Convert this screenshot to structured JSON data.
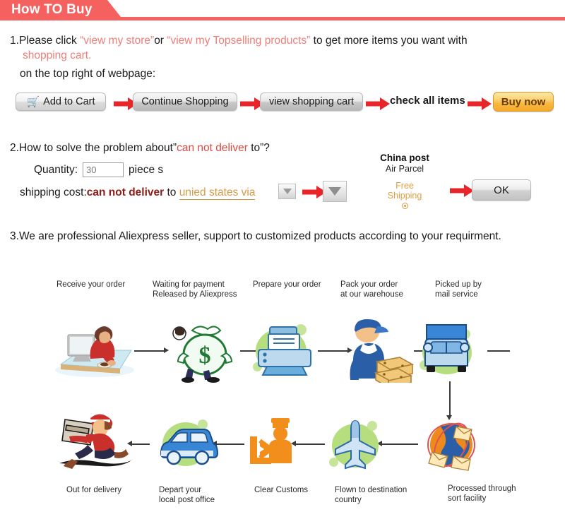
{
  "banner": {
    "title": "How TO Buy",
    "color": "#f4615e"
  },
  "step1": {
    "num": "1.",
    "lead": "Please click",
    "q_open": "“",
    "link1": "view my store",
    "q_close": "”",
    "or": "or",
    "link2": "view my Topselling products",
    "tail": "to get more items you want with",
    "line2": "shopping cart.",
    "line3": "on the top right of webpage:",
    "buttons": [
      {
        "label": "Add to Cart",
        "icon": "shopping-cart-icon",
        "style": "light"
      },
      {
        "label": "Continue Shopping",
        "style": "dark"
      },
      {
        "label": "view shopping cart",
        "style": "dark"
      },
      {
        "label": "check all items",
        "style": "plain"
      },
      {
        "label": "Buy now",
        "style": "buy"
      }
    ]
  },
  "step2": {
    "num": "2.",
    "title_a": "How to solve the problem about”",
    "title_red": "can not deliver",
    "title_b": " to”?",
    "quantity_label": "Quantity:",
    "quantity_value": "30",
    "quantity_unit": "piece s",
    "shipping_label": "shipping cost:",
    "shipping_red": "can not deliver",
    "shipping_to": "to",
    "destination": "unied states via",
    "carrier_line1": "China post",
    "carrier_line2": "Air Parcel",
    "free_line1": "Free",
    "free_line2": "Shipping",
    "ok_label": "OK"
  },
  "step3": {
    "num": "3.",
    "text": "We are professional Aliexpress seller, support to customized products according to your requirment."
  },
  "flow": {
    "top": [
      {
        "label": "Receive your order",
        "icon": "person-at-computer-icon"
      },
      {
        "label": "Waiting for payment\nReleased by Aliexpress",
        "icon": "money-bag-icon"
      },
      {
        "label": "Prepare your order",
        "icon": "printer-icon"
      },
      {
        "label": "Pack your order\nat our warehouse",
        "icon": "warehouse-worker-icon"
      },
      {
        "label": "Picked up by\nmail service",
        "icon": "delivery-truck-icon"
      }
    ],
    "bottom": [
      {
        "label": "Out for delivery",
        "icon": "running-courier-icon"
      },
      {
        "label": "Depart your\nlocal post office",
        "icon": "delivery-van-icon"
      },
      {
        "label": "Clear Customs",
        "icon": "customs-officer-icon"
      },
      {
        "label": "Flown to destination\ncountry",
        "icon": "airplane-icon"
      },
      {
        "label": "Processed through\nsort facility",
        "icon": "globe-mail-icon"
      }
    ]
  }
}
